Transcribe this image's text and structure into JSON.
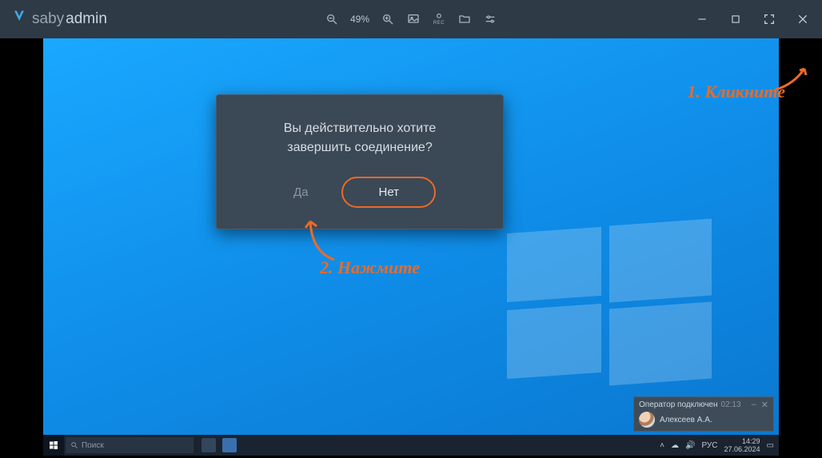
{
  "app": {
    "brand_a": "saby",
    "brand_b": "admin"
  },
  "toolbar": {
    "zoom": "49%"
  },
  "dialog": {
    "line1": "Вы действительно хотите",
    "line2": "завершить соединение?",
    "yes": "Да",
    "no": "Нет"
  },
  "notification": {
    "title": "Оператор подключен",
    "elapsed": "02:13",
    "operator": "Алексеев А.А."
  },
  "taskbar": {
    "search_placeholder": "Поиск",
    "lang": "РУС",
    "time": "14:29",
    "date": "27.06.2024"
  },
  "annotations": {
    "step1": "1. Кликните",
    "step2": "2. Нажмите"
  }
}
